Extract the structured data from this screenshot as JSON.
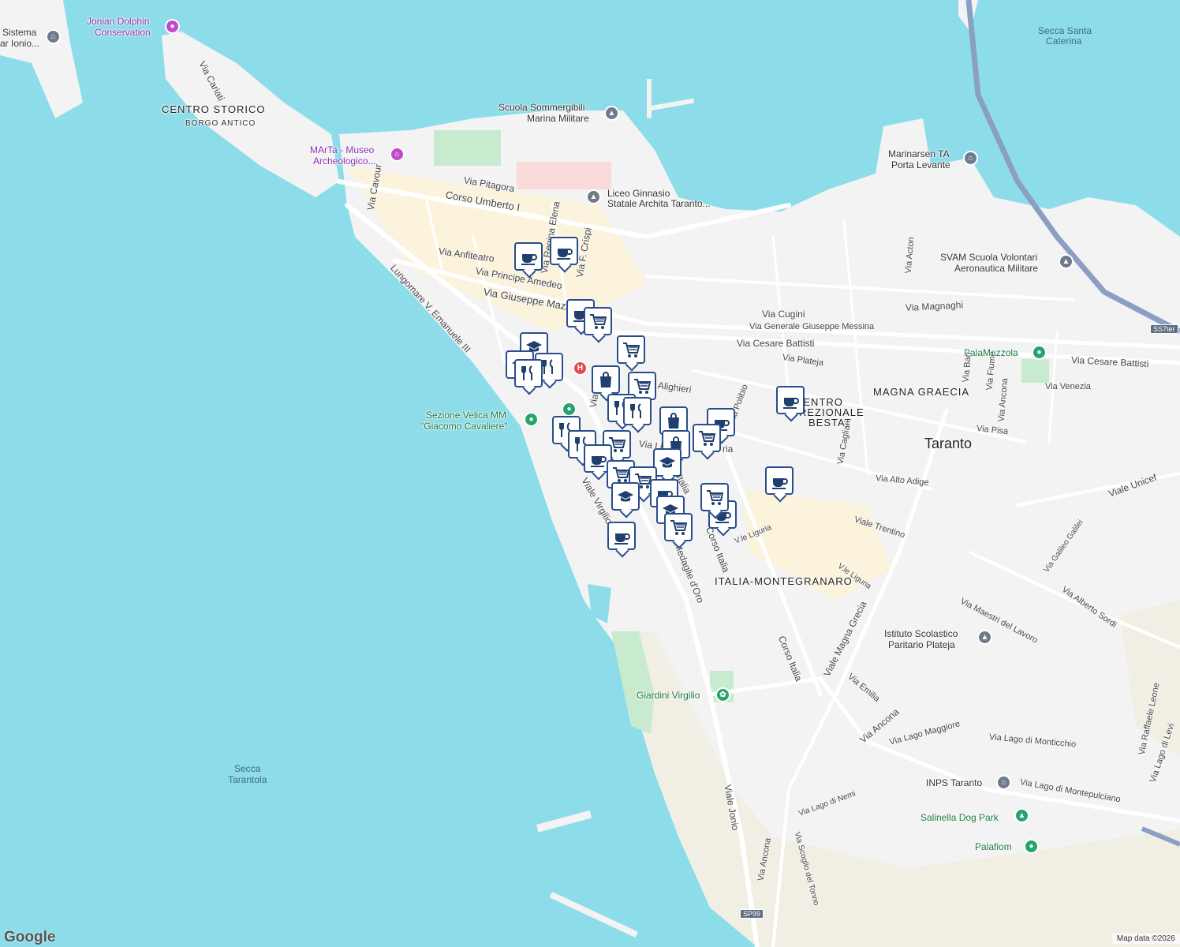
{
  "map": {
    "attribution": "Map data ©2026",
    "logo": "Google",
    "colors": {
      "water": "#8ddcea",
      "land": "#f3f3f4",
      "park": "#c8ebcf",
      "sand": "#f1efe4",
      "highway": "#8a9fc2",
      "marker_border": "#2a4e8c"
    }
  },
  "places": [
    {
      "key": "sistema",
      "text": "Sistema"
    },
    {
      "key": "polo",
      "text": "ar Ionio..."
    },
    {
      "key": "dolphin1",
      "text": "Jonian Dolphin"
    },
    {
      "key": "dolphin2",
      "text": "Conservation"
    },
    {
      "key": "centro",
      "text": "CENTRO STORICO"
    },
    {
      "key": "borgo",
      "text": "BORGO ANTICO"
    },
    {
      "key": "marta1",
      "text": "MArTa - Museo"
    },
    {
      "key": "marta2",
      "text": "Archeologico..."
    },
    {
      "key": "scuola1",
      "text": "Scuola Sommergibili"
    },
    {
      "key": "scuola2",
      "text": "Marina Militare"
    },
    {
      "key": "liceo1",
      "text": "Liceo Ginnasio"
    },
    {
      "key": "liceo2",
      "text": "Statale Archita Taranto..."
    },
    {
      "key": "secca1",
      "text": "Secca Santa"
    },
    {
      "key": "secca2",
      "text": "Caterina"
    },
    {
      "key": "marinarsen1",
      "text": "Marinarsen TA"
    },
    {
      "key": "marinarsen2",
      "text": "Porta Levante"
    },
    {
      "key": "svam1",
      "text": "SVAM Scuola Volontari"
    },
    {
      "key": "svam2",
      "text": "Aeronautica Militare"
    },
    {
      "key": "palamazzola",
      "text": "PalaMazzola"
    },
    {
      "key": "magna",
      "text": "MAGNA GRAECIA"
    },
    {
      "key": "taranto",
      "text": "Taranto"
    },
    {
      "key": "direz1",
      "text": "CENTRO"
    },
    {
      "key": "direz2",
      "text": "DIREZIONALE"
    },
    {
      "key": "direz3",
      "text": "BESTAT"
    },
    {
      "key": "velica1",
      "text": "Sezione Velica MM"
    },
    {
      "key": "velica2",
      "text": "\"Giacomo Cavaliere\""
    },
    {
      "key": "italia",
      "text": "ITALIA-MONTEGRANARO"
    },
    {
      "key": "plateja1",
      "text": "Istituto Scolastico"
    },
    {
      "key": "plateja2",
      "text": "Paritario Plateja"
    },
    {
      "key": "virgilio",
      "text": "Giardini Virgilio"
    },
    {
      "key": "inps",
      "text": "INPS Taranto"
    },
    {
      "key": "salinella",
      "text": "Salinella Dog Park"
    },
    {
      "key": "palafiom",
      "text": "Palafiom"
    },
    {
      "key": "tarantola1",
      "text": "Secca"
    },
    {
      "key": "tarantola2",
      "text": "Tarantola"
    }
  ],
  "streets": [
    {
      "key": "cariati",
      "text": "Via Cariati"
    },
    {
      "key": "pitagora",
      "text": "Via Pitagora"
    },
    {
      "key": "umberto",
      "text": "Corso Umberto I"
    },
    {
      "key": "cavour",
      "text": "Via Cavour"
    },
    {
      "key": "anfiteatro",
      "text": "Via Anfiteatro"
    },
    {
      "key": "amedeo",
      "text": "Via Principe Amedeo"
    },
    {
      "key": "mazzini",
      "text": "Via Giuseppe Mazzini"
    },
    {
      "key": "regina",
      "text": "Via Regina Elena"
    },
    {
      "key": "crispi",
      "text": "Via F. Crispi"
    },
    {
      "key": "lungomare",
      "text": "Lungomare V. Emanuele III"
    },
    {
      "key": "cugini",
      "text": "Via Cugini"
    },
    {
      "key": "magnaghi",
      "text": "Via Magnaghi"
    },
    {
      "key": "messina",
      "text": "Via Generale Giuseppe Messina"
    },
    {
      "key": "battisti1",
      "text": "Via Cesare Battisti"
    },
    {
      "key": "battisti2",
      "text": "Via Cesare Battisti"
    },
    {
      "key": "plateja",
      "text": "Via Plateja"
    },
    {
      "key": "acton",
      "text": "Via Acton"
    },
    {
      "key": "alighieri",
      "text": "Alighieri"
    },
    {
      "key": "venezia",
      "text": "Via Venezia"
    },
    {
      "key": "bari",
      "text": "Via Bari"
    },
    {
      "key": "fiume",
      "text": "Via Fiume"
    },
    {
      "key": "ancona1",
      "text": "Via Ancona"
    },
    {
      "key": "pisa",
      "text": "Via Pisa"
    },
    {
      "key": "polibio",
      "text": "Via Polibio"
    },
    {
      "key": "cagliari",
      "text": "Via Cagliari"
    },
    {
      "key": "altoadige",
      "text": "Via Alto Adige"
    },
    {
      "key": "unicef",
      "text": "Viale Unicef"
    },
    {
      "key": "trentino",
      "text": "Viale Trentino"
    },
    {
      "key": "liguria1",
      "text": "V.le Liguria"
    },
    {
      "key": "liguria2",
      "text": "V.le Liguria"
    },
    {
      "key": "galilei",
      "text": "Via Galileo Galilei"
    },
    {
      "key": "sordi",
      "text": "Via Alberto Sordi"
    },
    {
      "key": "maestri",
      "text": "Via Maestri del Lavoro"
    },
    {
      "key": "medaglie",
      "text": "Medaglie d'Oro"
    },
    {
      "key": "corso1",
      "text": "Corso Italia"
    },
    {
      "key": "corso2",
      "text": "Corso Italia"
    },
    {
      "key": "magnagrecia",
      "text": "Viale Magna Grecia"
    },
    {
      "key": "emilia",
      "text": "Via Emilia"
    },
    {
      "key": "ancona2",
      "text": "Via Ancona"
    },
    {
      "key": "maggiore",
      "text": "Via Lago Maggiore"
    },
    {
      "key": "monticchio",
      "text": "Via Lago di Monticchio"
    },
    {
      "key": "montepulciano",
      "text": "Via Lago di Montepulciano"
    },
    {
      "key": "nemi",
      "text": "Via Lago di Nemi"
    },
    {
      "key": "leone",
      "text": "Via Raffaele Leone"
    },
    {
      "key": "levi",
      "text": "Via Lago di Levi"
    },
    {
      "key": "jonio",
      "text": "Viale Jonio"
    },
    {
      "key": "ancona3",
      "text": "Via Ancona"
    },
    {
      "key": "scoglio",
      "text": "Via Scoglio del Tonno"
    },
    {
      "key": "virgilio_st",
      "text": "Viale Virgilio"
    },
    {
      "key": "italia_st",
      "text": "Italia"
    },
    {
      "key": "nitti",
      "text": "Via Nitti"
    },
    {
      "key": "ligia",
      "text": "Via Ligia"
    },
    {
      "key": "ria",
      "text": "ria"
    }
  ],
  "shields": [
    {
      "key": "ss7ter",
      "text": "SS7ter"
    },
    {
      "key": "sp99",
      "text": "SP99"
    }
  ],
  "markers": [
    {
      "type": "coffee-icon"
    },
    {
      "type": "coffee-icon"
    },
    {
      "type": "coffee-icon"
    },
    {
      "type": "cart-icon"
    },
    {
      "type": "cart-icon"
    },
    {
      "type": "school-icon"
    },
    {
      "type": "restaurant-icon"
    },
    {
      "type": "school-icon"
    },
    {
      "type": "restaurant-icon"
    },
    {
      "type": "bag-icon"
    },
    {
      "type": "cart-icon"
    },
    {
      "type": "restaurant-icon"
    },
    {
      "type": "restaurant-icon"
    },
    {
      "type": "bag-icon"
    },
    {
      "type": "coffee-icon"
    },
    {
      "type": "bag-icon"
    },
    {
      "type": "cart-icon"
    },
    {
      "type": "restaurant-icon"
    },
    {
      "type": "restaurant-icon"
    },
    {
      "type": "cart-icon"
    },
    {
      "type": "coffee-icon"
    },
    {
      "type": "cart-icon"
    },
    {
      "type": "school-icon"
    },
    {
      "type": "cart-icon"
    },
    {
      "type": "school-icon"
    },
    {
      "type": "coffee-icon"
    },
    {
      "type": "school-icon"
    },
    {
      "type": "cart-icon"
    },
    {
      "type": "coffee-icon"
    },
    {
      "type": "coffee-icon"
    },
    {
      "type": "coffee-icon"
    },
    {
      "type": "coffee-icon"
    },
    {
      "type": "cart-icon"
    }
  ]
}
